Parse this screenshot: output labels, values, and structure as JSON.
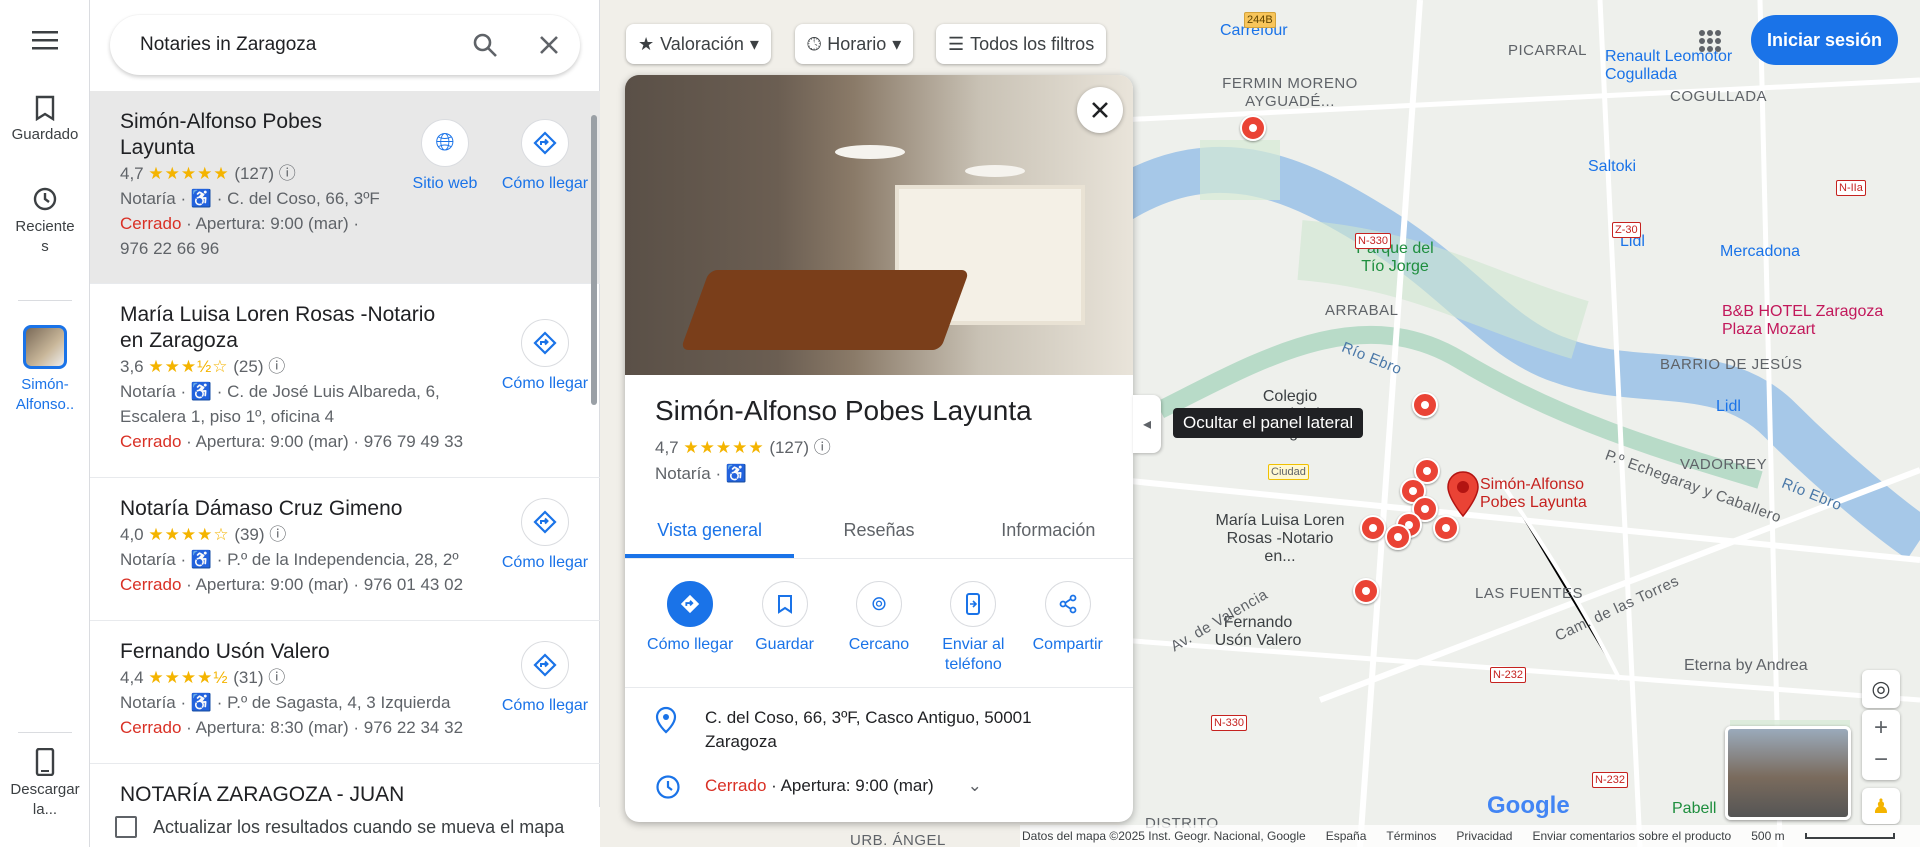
{
  "rail": {
    "menu_icon": "menu-icon",
    "saved_label": "Guardado",
    "recent_label": "Reciente s",
    "selected_thumb_label": "Simón-Alfonso..",
    "download_label": "Descargar la..."
  },
  "search": {
    "query": "Notaries in Zaragoza"
  },
  "results": [
    {
      "name": "Simón-Alfonso Pobes Layunta",
      "rating": "4,7",
      "stars": "★★★★★",
      "reviews": "(127)",
      "line2": "Notaría · ♿ · C. del Coso, 66, 3ºF",
      "closed": "Cerrado",
      "line3": " · Apertura: 9:00 (mar) ·",
      "line4": "976 22 66 96",
      "website_label": "Sitio web",
      "directions_label": "Cómo llegar"
    },
    {
      "name": "María Luisa Loren Rosas -Notario en Zaragoza",
      "rating": "3,6",
      "stars": "★★★½☆",
      "reviews": "(25)",
      "line2": "Notaría · ♿ · C. de José Luis Albareda, 6,",
      "line2b": "Escalera 1, piso 1º, oficina 4",
      "closed": "Cerrado",
      "line3": " · Apertura: 9:00 (mar) · 976 79 49 33",
      "directions_label": "Cómo llegar"
    },
    {
      "name": "Notaría Dámaso Cruz Gimeno",
      "rating": "4,0",
      "stars": "★★★★☆",
      "reviews": "(39)",
      "line2": "Notaría · ♿ · P.º de la Independencia, 28, 2º",
      "closed": "Cerrado",
      "line3": " · Apertura: 9:00 (mar) · 976 01 43 02",
      "directions_label": "Cómo llegar"
    },
    {
      "name": "Fernando Usón Valero",
      "rating": "4,4",
      "stars": "★★★★½",
      "reviews": "(31)",
      "line2": "Notaría · ♿ · P.º de Sagasta, 4, 3 Izquierda",
      "closed": "Cerrado",
      "line3": " · Apertura: 8:30 (mar) · 976 22 34 32",
      "directions_label": "Cómo llegar"
    },
    {
      "name": "NOTARÍA ZARAGOZA - JUAN"
    }
  ],
  "footer": {
    "update_label": "Actualizar los resultados cuando se mueva el mapa"
  },
  "chips": {
    "rating": "Valoración",
    "hours": "Horario",
    "filters": "Todos los filtros"
  },
  "signin": "Iniciar sesión",
  "tooltip": "Ocultar el panel lateral",
  "card": {
    "title": "Simón-Alfonso Pobes Layunta",
    "rating": "4,7",
    "stars": "★★★★★",
    "reviews": "(127)",
    "category": "Notaría · ♿",
    "tabs": [
      "Vista general",
      "Reseñas",
      "Información"
    ],
    "actions": [
      "Cómo llegar",
      "Guardar",
      "Cercano",
      "Enviar al teléfono",
      "Compartir"
    ],
    "address": "C. del Coso, 66, 3ºF, Casco Antiguo, 50001 Zaragoza",
    "closed": "Cerrado",
    "hours": " · Apertura: 9:00 (mar)"
  },
  "map": {
    "areas": [
      "PICARRAL",
      "FERMIN MORENO AYGUADÉ...",
      "COGULLADA",
      "ARRABAL",
      "BARRIO DE JESÚS",
      "VADORREY",
      "LAS FUENTES",
      "DISTRITO",
      "URB. ÁNGEL"
    ],
    "pois": [
      "Carrefour",
      "Renault Leomotor Cogullada",
      "Saltoki",
      "Lidl",
      "Mercadona",
      "Parque del Tío Jorge",
      "B&B HOTEL Zaragoza Plaza Mozart",
      "Lidl",
      "Colegio Notarial de Aragón",
      "Eterna by Andrea",
      "Pabell"
    ],
    "pin_labels": [
      "Simón-Alfonso Pobes Layunta",
      "María Luisa Loren Rosas -Notario en...",
      "Fernando Usón Valero"
    ],
    "streets": [
      "Río Ebro",
      "Río Ebro",
      "P.º Echegaray y Caballero",
      "Av. de Valencia",
      "Cam. de las Torres"
    ],
    "roads": [
      "N-330",
      "N-330",
      "N-232",
      "N-330",
      "Z-30",
      "N-IIa",
      "N-232",
      "Ciudad",
      "244B"
    ]
  },
  "bottombar": [
    "Datos del mapa ©2025 Inst. Geogr. Nacional, Google",
    "España",
    "Términos",
    "Privacidad",
    "Enviar comentarios sobre el producto",
    "500 m"
  ],
  "google_logo": "Google"
}
